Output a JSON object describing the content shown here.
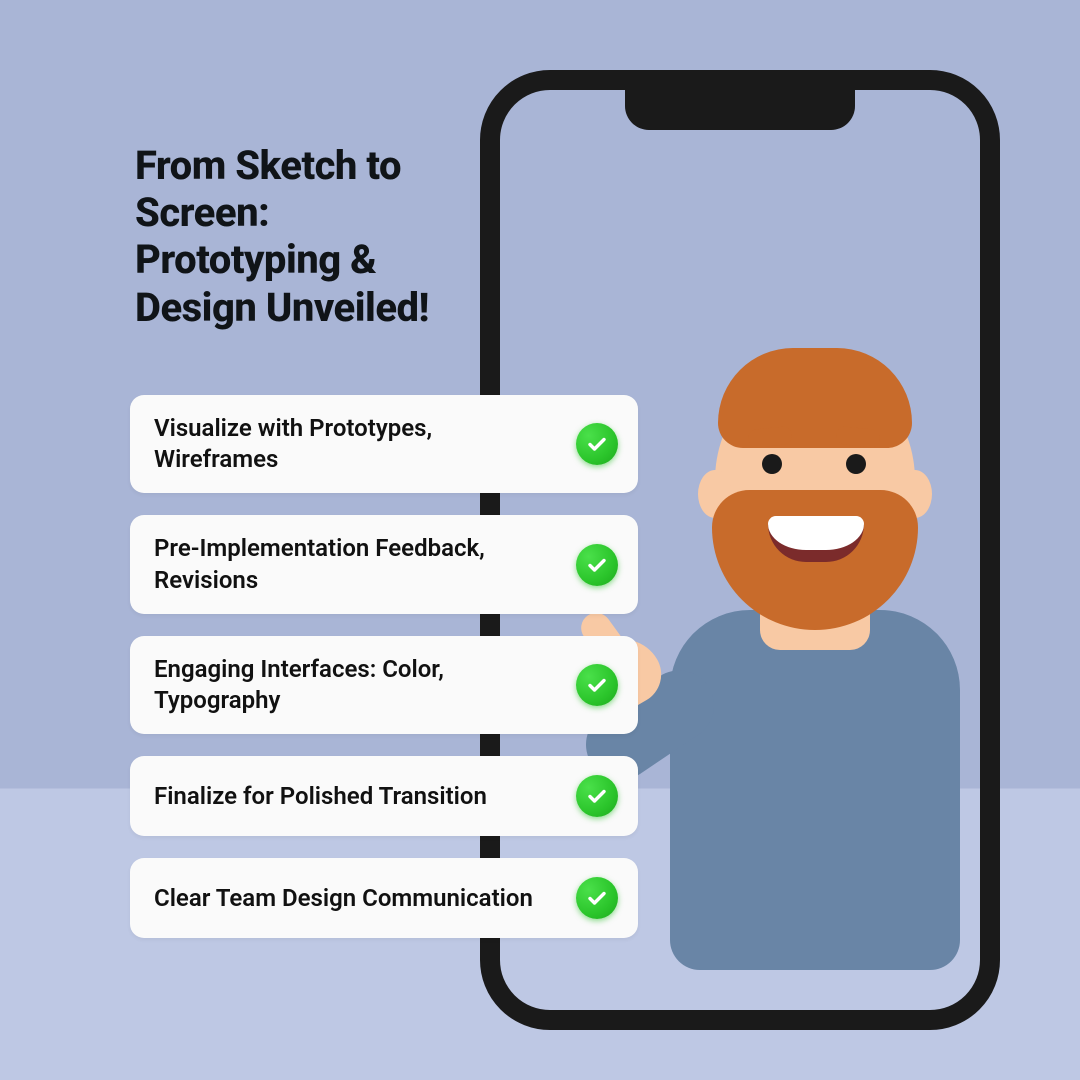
{
  "headline": "From Sketch to Screen: Prototyping & Design Unveiled!",
  "items": [
    {
      "label": "Visualize with Prototypes, Wireframes"
    },
    {
      "label": "Pre-Implementation Feedback, Revisions"
    },
    {
      "label": "Engaging Interfaces: Color, Typography"
    },
    {
      "label": "Finalize for Polished Transition"
    },
    {
      "label": "Clear Team Design Communication"
    }
  ]
}
